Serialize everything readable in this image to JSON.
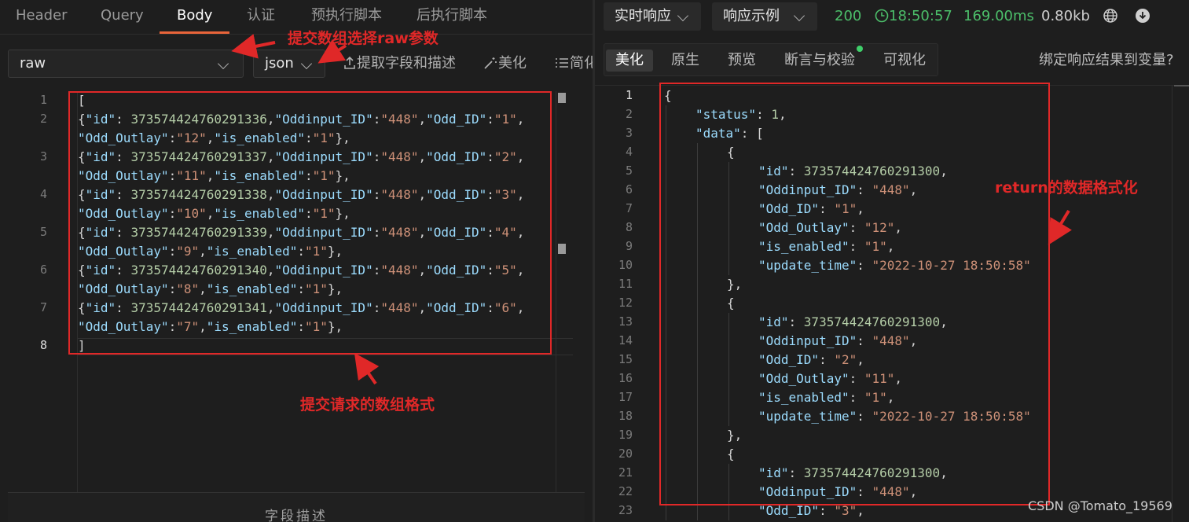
{
  "request": {
    "tabs": [
      "Header",
      "Query",
      "Body",
      "认证",
      "预执行脚本",
      "后执行脚本"
    ],
    "active_tab": "Body",
    "body_type": "raw",
    "body_format": "json",
    "tools": {
      "extract": "提取字段和描述",
      "beautify": "美化",
      "simplify": "简化"
    },
    "code_lines": [
      {
        "num": "1",
        "rows": [
          [
            [
              "p",
              "["
            ]
          ]
        ]
      },
      {
        "num": "2",
        "rows": [
          [
            [
              "p",
              "{"
            ],
            [
              "k",
              "\"id\""
            ],
            [
              "p",
              ": "
            ],
            [
              "n",
              "373574424760291336"
            ],
            [
              "p",
              ","
            ],
            [
              "k",
              "\"Oddinput_ID\""
            ],
            [
              "p",
              ":"
            ],
            [
              "s",
              "\"448\""
            ],
            [
              "p",
              ","
            ],
            [
              "k",
              "\"Odd_ID\""
            ],
            [
              "p",
              ":"
            ],
            [
              "s",
              "\"1\""
            ],
            [
              "p",
              ","
            ]
          ],
          [
            [
              "k",
              "\"Odd_Outlay\""
            ],
            [
              "p",
              ":"
            ],
            [
              "s",
              "\"12\""
            ],
            [
              "p",
              ","
            ],
            [
              "k",
              "\"is_enabled\""
            ],
            [
              "p",
              ":"
            ],
            [
              "s",
              "\"1\""
            ],
            [
              "p",
              "},"
            ]
          ]
        ]
      },
      {
        "num": "3",
        "rows": [
          [
            [
              "p",
              "{"
            ],
            [
              "k",
              "\"id\""
            ],
            [
              "p",
              ": "
            ],
            [
              "n",
              "373574424760291337"
            ],
            [
              "p",
              ","
            ],
            [
              "k",
              "\"Oddinput_ID\""
            ],
            [
              "p",
              ":"
            ],
            [
              "s",
              "\"448\""
            ],
            [
              "p",
              ","
            ],
            [
              "k",
              "\"Odd_ID\""
            ],
            [
              "p",
              ":"
            ],
            [
              "s",
              "\"2\""
            ],
            [
              "p",
              ","
            ]
          ],
          [
            [
              "k",
              "\"Odd_Outlay\""
            ],
            [
              "p",
              ":"
            ],
            [
              "s",
              "\"11\""
            ],
            [
              "p",
              ","
            ],
            [
              "k",
              "\"is_enabled\""
            ],
            [
              "p",
              ":"
            ],
            [
              "s",
              "\"1\""
            ],
            [
              "p",
              "},"
            ]
          ]
        ]
      },
      {
        "num": "4",
        "rows": [
          [
            [
              "p",
              "{"
            ],
            [
              "k",
              "\"id\""
            ],
            [
              "p",
              ": "
            ],
            [
              "n",
              "373574424760291338"
            ],
            [
              "p",
              ","
            ],
            [
              "k",
              "\"Oddinput_ID\""
            ],
            [
              "p",
              ":"
            ],
            [
              "s",
              "\"448\""
            ],
            [
              "p",
              ","
            ],
            [
              "k",
              "\"Odd_ID\""
            ],
            [
              "p",
              ":"
            ],
            [
              "s",
              "\"3\""
            ],
            [
              "p",
              ","
            ]
          ],
          [
            [
              "k",
              "\"Odd_Outlay\""
            ],
            [
              "p",
              ":"
            ],
            [
              "s",
              "\"10\""
            ],
            [
              "p",
              ","
            ],
            [
              "k",
              "\"is_enabled\""
            ],
            [
              "p",
              ":"
            ],
            [
              "s",
              "\"1\""
            ],
            [
              "p",
              "},"
            ]
          ]
        ]
      },
      {
        "num": "5",
        "rows": [
          [
            [
              "p",
              "{"
            ],
            [
              "k",
              "\"id\""
            ],
            [
              "p",
              ": "
            ],
            [
              "n",
              "373574424760291339"
            ],
            [
              "p",
              ","
            ],
            [
              "k",
              "\"Oddinput_ID\""
            ],
            [
              "p",
              ":"
            ],
            [
              "s",
              "\"448\""
            ],
            [
              "p",
              ","
            ],
            [
              "k",
              "\"Odd_ID\""
            ],
            [
              "p",
              ":"
            ],
            [
              "s",
              "\"4\""
            ],
            [
              "p",
              ","
            ]
          ],
          [
            [
              "k",
              "\"Odd_Outlay\""
            ],
            [
              "p",
              ":"
            ],
            [
              "s",
              "\"9\""
            ],
            [
              "p",
              ","
            ],
            [
              "k",
              "\"is_enabled\""
            ],
            [
              "p",
              ":"
            ],
            [
              "s",
              "\"1\""
            ],
            [
              "p",
              "},"
            ]
          ]
        ]
      },
      {
        "num": "6",
        "rows": [
          [
            [
              "p",
              "{"
            ],
            [
              "k",
              "\"id\""
            ],
            [
              "p",
              ": "
            ],
            [
              "n",
              "373574424760291340"
            ],
            [
              "p",
              ","
            ],
            [
              "k",
              "\"Oddinput_ID\""
            ],
            [
              "p",
              ":"
            ],
            [
              "s",
              "\"448\""
            ],
            [
              "p",
              ","
            ],
            [
              "k",
              "\"Odd_ID\""
            ],
            [
              "p",
              ":"
            ],
            [
              "s",
              "\"5\""
            ],
            [
              "p",
              ","
            ]
          ],
          [
            [
              "k",
              "\"Odd_Outlay\""
            ],
            [
              "p",
              ":"
            ],
            [
              "s",
              "\"8\""
            ],
            [
              "p",
              ","
            ],
            [
              "k",
              "\"is_enabled\""
            ],
            [
              "p",
              ":"
            ],
            [
              "s",
              "\"1\""
            ],
            [
              "p",
              "},"
            ]
          ]
        ]
      },
      {
        "num": "7",
        "rows": [
          [
            [
              "p",
              "{"
            ],
            [
              "k",
              "\"id\""
            ],
            [
              "p",
              ": "
            ],
            [
              "n",
              "373574424760291341"
            ],
            [
              "p",
              ","
            ],
            [
              "k",
              "\"Oddinput_ID\""
            ],
            [
              "p",
              ":"
            ],
            [
              "s",
              "\"448\""
            ],
            [
              "p",
              ","
            ],
            [
              "k",
              "\"Odd_ID\""
            ],
            [
              "p",
              ":"
            ],
            [
              "s",
              "\"6\""
            ],
            [
              "p",
              ","
            ]
          ],
          [
            [
              "k",
              "\"Odd_Outlay\""
            ],
            [
              "p",
              ":"
            ],
            [
              "s",
              "\"7\""
            ],
            [
              "p",
              ","
            ],
            [
              "k",
              "\"is_enabled\""
            ],
            [
              "p",
              ":"
            ],
            [
              "s",
              "\"1\""
            ],
            [
              "p",
              "},"
            ]
          ]
        ]
      },
      {
        "num": "8",
        "rows": [
          [
            [
              "p",
              "]"
            ]
          ]
        ]
      }
    ],
    "current_line": "8",
    "field_desc": "字段描述"
  },
  "response": {
    "mode": "实时响应",
    "example": "响应示例",
    "status_code": "200",
    "time": "18:50:57",
    "duration": "169.00ms",
    "size": "0.80kb",
    "tabs": [
      "美化",
      "原生",
      "预览",
      "断言与校验",
      "可视化"
    ],
    "active_tab": "美化",
    "bind_link": "绑定响应结果到变量?",
    "code_lines": [
      {
        "num": "1",
        "indent": 0,
        "t": [
          [
            "p",
            "{"
          ]
        ]
      },
      {
        "num": "2",
        "indent": 1,
        "t": [
          [
            "k",
            "\"status\""
          ],
          [
            "p",
            ": "
          ],
          [
            "n",
            "1"
          ],
          [
            "p",
            ","
          ]
        ]
      },
      {
        "num": "3",
        "indent": 1,
        "t": [
          [
            "k",
            "\"data\""
          ],
          [
            "p",
            ": ["
          ]
        ]
      },
      {
        "num": "4",
        "indent": 2,
        "t": [
          [
            "p",
            "{"
          ]
        ]
      },
      {
        "num": "5",
        "indent": 3,
        "t": [
          [
            "k",
            "\"id\""
          ],
          [
            "p",
            ": "
          ],
          [
            "n",
            "373574424760291300"
          ],
          [
            "p",
            ","
          ]
        ]
      },
      {
        "num": "6",
        "indent": 3,
        "t": [
          [
            "k",
            "\"Oddinput_ID\""
          ],
          [
            "p",
            ": "
          ],
          [
            "s",
            "\"448\""
          ],
          [
            "p",
            ","
          ]
        ]
      },
      {
        "num": "7",
        "indent": 3,
        "t": [
          [
            "k",
            "\"Odd_ID\""
          ],
          [
            "p",
            ": "
          ],
          [
            "s",
            "\"1\""
          ],
          [
            "p",
            ","
          ]
        ]
      },
      {
        "num": "8",
        "indent": 3,
        "t": [
          [
            "k",
            "\"Odd_Outlay\""
          ],
          [
            "p",
            ": "
          ],
          [
            "s",
            "\"12\""
          ],
          [
            "p",
            ","
          ]
        ]
      },
      {
        "num": "9",
        "indent": 3,
        "t": [
          [
            "k",
            "\"is_enabled\""
          ],
          [
            "p",
            ": "
          ],
          [
            "s",
            "\"1\""
          ],
          [
            "p",
            ","
          ]
        ]
      },
      {
        "num": "10",
        "indent": 3,
        "t": [
          [
            "k",
            "\"update_time\""
          ],
          [
            "p",
            ": "
          ],
          [
            "s",
            "\"2022-10-27 18:50:58\""
          ]
        ]
      },
      {
        "num": "11",
        "indent": 2,
        "t": [
          [
            "p",
            "},"
          ]
        ]
      },
      {
        "num": "12",
        "indent": 2,
        "t": [
          [
            "p",
            "{"
          ]
        ]
      },
      {
        "num": "13",
        "indent": 3,
        "t": [
          [
            "k",
            "\"id\""
          ],
          [
            "p",
            ": "
          ],
          [
            "n",
            "373574424760291300"
          ],
          [
            "p",
            ","
          ]
        ]
      },
      {
        "num": "14",
        "indent": 3,
        "t": [
          [
            "k",
            "\"Oddinput_ID\""
          ],
          [
            "p",
            ": "
          ],
          [
            "s",
            "\"448\""
          ],
          [
            "p",
            ","
          ]
        ]
      },
      {
        "num": "15",
        "indent": 3,
        "t": [
          [
            "k",
            "\"Odd_ID\""
          ],
          [
            "p",
            ": "
          ],
          [
            "s",
            "\"2\""
          ],
          [
            "p",
            ","
          ]
        ]
      },
      {
        "num": "16",
        "indent": 3,
        "t": [
          [
            "k",
            "\"Odd_Outlay\""
          ],
          [
            "p",
            ": "
          ],
          [
            "s",
            "\"11\""
          ],
          [
            "p",
            ","
          ]
        ]
      },
      {
        "num": "17",
        "indent": 3,
        "t": [
          [
            "k",
            "\"is_enabled\""
          ],
          [
            "p",
            ": "
          ],
          [
            "s",
            "\"1\""
          ],
          [
            "p",
            ","
          ]
        ]
      },
      {
        "num": "18",
        "indent": 3,
        "t": [
          [
            "k",
            "\"update_time\""
          ],
          [
            "p",
            ": "
          ],
          [
            "s",
            "\"2022-10-27 18:50:58\""
          ]
        ]
      },
      {
        "num": "19",
        "indent": 2,
        "t": [
          [
            "p",
            "},"
          ]
        ]
      },
      {
        "num": "20",
        "indent": 2,
        "t": [
          [
            "p",
            "{"
          ]
        ]
      },
      {
        "num": "21",
        "indent": 3,
        "t": [
          [
            "k",
            "\"id\""
          ],
          [
            "p",
            ": "
          ],
          [
            "n",
            "373574424760291300"
          ],
          [
            "p",
            ","
          ]
        ]
      },
      {
        "num": "22",
        "indent": 3,
        "t": [
          [
            "k",
            "\"Oddinput_ID\""
          ],
          [
            "p",
            ": "
          ],
          [
            "s",
            "\"448\""
          ],
          [
            "p",
            ","
          ]
        ]
      },
      {
        "num": "23",
        "indent": 3,
        "t": [
          [
            "k",
            "\"Odd_ID\""
          ],
          [
            "p",
            ": "
          ],
          [
            "s",
            "\"3\""
          ],
          [
            "p",
            ","
          ]
        ]
      }
    ],
    "current_line": "1"
  },
  "annotations": {
    "raw_param": "提交数组选择raw参数",
    "request_format": "提交请求的数组格式",
    "return_format": "return的数据格式化"
  },
  "watermark": "CSDN @Tomato_19569",
  "colors": {
    "accent": "#e8643a",
    "status_ok": "#4cbf6a",
    "annotation": "#e02828"
  }
}
